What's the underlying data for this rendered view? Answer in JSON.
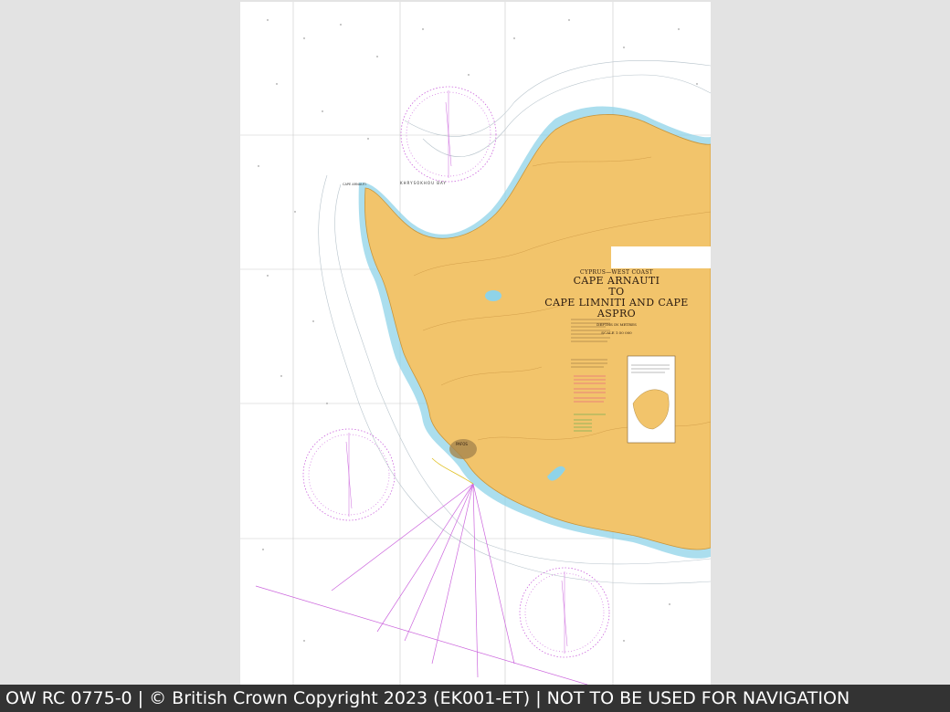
{
  "chart": {
    "region_label": "CYPRUS—WEST COAST",
    "title_line_1": "CAPE ARNAUTI",
    "title_line_2": "TO",
    "title_line_3": "CAPE LIMNITI AND CAPE ASPRO",
    "depth_note": "DEPTHS IN METRES",
    "scale_note": "SCALE 1:50 000",
    "bay_label": "KHRYSOKHOU BAY",
    "cape_label": "CAPE ARNAUTI",
    "town_label": "PAFOS"
  },
  "colors": {
    "land": "#f2c46b",
    "shallow_water": "#8fd3e8",
    "rose": "#cc66dd",
    "background": "#e3e3e3",
    "footer": "#333333"
  },
  "footer": {
    "text": "OW RC 0775-0 | © British Crown Copyright 2023 (EK001-ET) | NOT TO BE USED FOR NAVIGATION"
  }
}
